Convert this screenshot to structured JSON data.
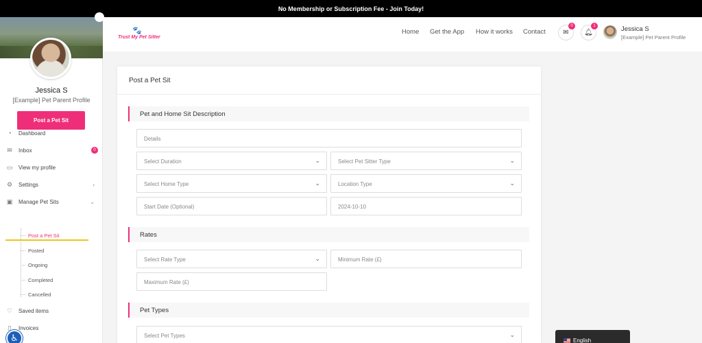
{
  "announcement": "No Membership or Subscription Fee - Join Today!",
  "brand": {
    "logo_text": "Trust My Pet Sitter",
    "accent": "#ef2e79"
  },
  "header": {
    "menu": [
      "Home",
      "Get the App",
      "How it works",
      "Contact"
    ],
    "mail_badge": "0",
    "bell_badge": "1",
    "user_name": "Jessica S",
    "user_sub": "[Example] Pet Parent Profile"
  },
  "sidebar": {
    "name": "Jessica S",
    "sub": "[Example] Pet Parent Profile",
    "post_button": "Post a Pet Sit",
    "items": [
      {
        "label": "Dashboard",
        "icon": "dashboard-icon"
      },
      {
        "label": "Inbox",
        "icon": "inbox-icon",
        "badge": "0"
      },
      {
        "label": "View my profile",
        "icon": "monitor-icon"
      },
      {
        "label": "Settings",
        "icon": "gear-icon"
      },
      {
        "label": "Manage Pet Sits",
        "icon": "calendar-icon"
      },
      {
        "label": "Saved items",
        "icon": "heart-icon"
      },
      {
        "label": "Invoices",
        "icon": "file-icon"
      }
    ],
    "sub_items": [
      "Post a Pet Sit",
      "Posted",
      "Ongoing",
      "Completed",
      "Cancelled"
    ]
  },
  "form": {
    "title": "Post a Pet Sit",
    "section1": "Pet and Home Sit Description",
    "details_ph": "Details",
    "duration_ph": "Select Duration",
    "sitter_type_ph": "Select Pet Sitter Type",
    "home_type_ph": "Select Home Type",
    "location_type_ph": "Location Type",
    "start_date_ph": "Start Date (Optional)",
    "end_date_value": "2024-10-10",
    "section2": "Rates",
    "rate_type_ph": "Select Rate Type",
    "min_rate_ph": "Minimum Rate (£)",
    "max_rate_ph": "Maximum Rate (£)",
    "section3": "Pet Types",
    "pet_types_ph": "Select Pet Types"
  },
  "language": "English"
}
